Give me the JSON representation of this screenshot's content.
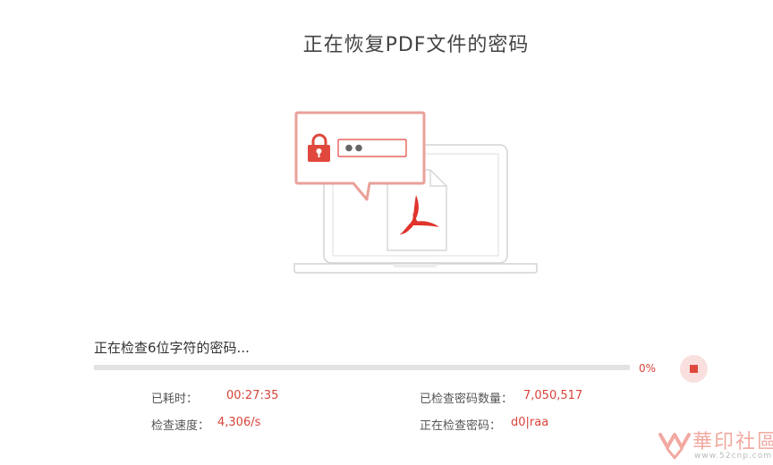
{
  "title": "正在恢复PDF文件的密码",
  "status_text": "正在检查6位字符的密码...",
  "progress": {
    "percent": 0,
    "label": "0%"
  },
  "stats": {
    "elapsed": {
      "label": "已耗时：",
      "value": "00:27:35"
    },
    "speed": {
      "label": "检查速度：",
      "value": "4,306/s"
    },
    "checked_count": {
      "label": "已检查密码数量：",
      "value": "7,050,517"
    },
    "current_password": {
      "label": "正在检查密码：",
      "value": "d0|raa"
    }
  },
  "watermark": {
    "text": "華印社區",
    "url": "www.52cnp.com"
  },
  "colors": {
    "accent": "#e0483d",
    "accent_light": "#f9e0df",
    "bubble": "#e9a199",
    "track": "#e2e2e2"
  },
  "icons": [
    "lock-icon",
    "pdf-file-icon",
    "laptop-icon",
    "stop-icon"
  ]
}
